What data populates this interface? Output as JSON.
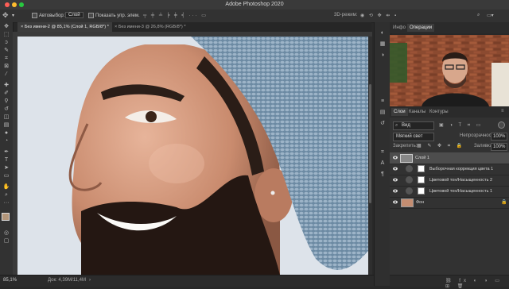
{
  "window": {
    "title": "Adobe Photoshop 2020"
  },
  "options_bar": {
    "auto_select_label": "Автовыбор:",
    "auto_select_value": "Слой",
    "show_controls_label": "Показать упр. элем."
  },
  "document_tabs": [
    {
      "label": "Без имени-2 @ 85,1% (Слой 1, RGB/8*) *"
    },
    {
      "label": "Без имени-3 @ 26,8% (RGB/8*) *"
    }
  ],
  "status_bar": {
    "zoom": "85,1%",
    "doc_info": "Док: 4,39М/11,4М"
  },
  "info_panel": {
    "tabs": [
      "Инфо",
      "Операции"
    ]
  },
  "layers_panel": {
    "tabs": [
      "Слои",
      "Каналы",
      "Контуры"
    ],
    "filter_label": "Вид",
    "blend_mode": "Мягкий свет",
    "opacity_label": "Непрозрачность:",
    "opacity_value": "100%",
    "lock_label": "Закрепить:",
    "fill_label": "Заливка:",
    "fill_value": "100%",
    "layers": [
      {
        "name": "Слой 1"
      },
      {
        "name": "Выборочная коррекция цвета 1"
      },
      {
        "name": "Цветовой тон/Насыщенность 2"
      },
      {
        "name": "Цветовой тон/Насыщенность 1"
      },
      {
        "name": "Фон"
      }
    ]
  },
  "colors": {
    "accent": "#2d6bd6",
    "panel": "#323232",
    "workspace": "#282828"
  }
}
